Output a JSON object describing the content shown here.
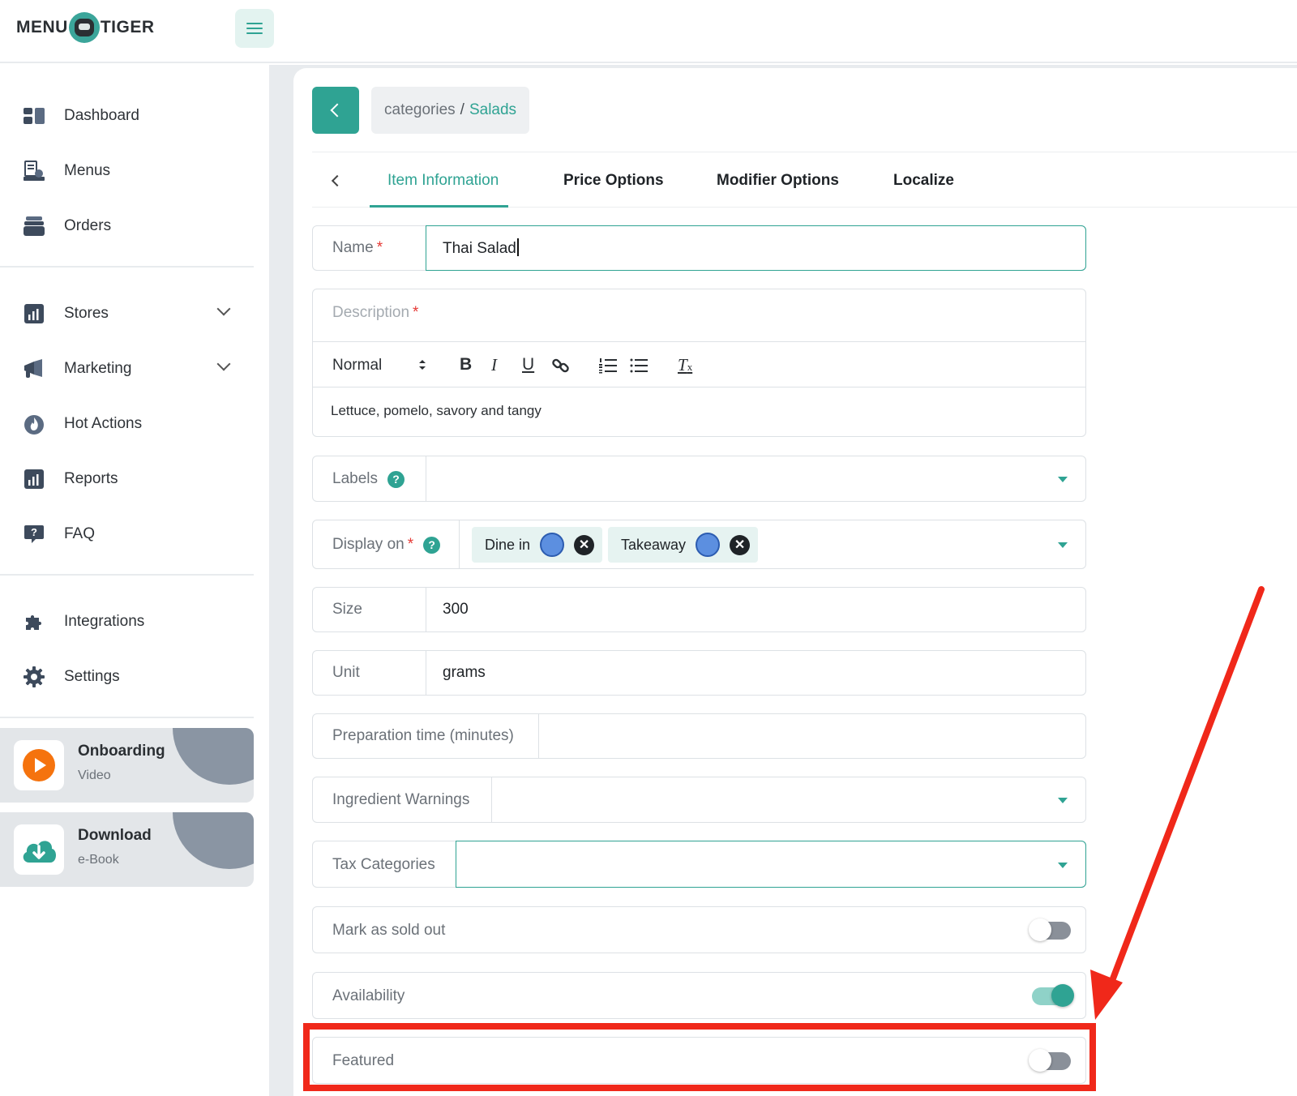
{
  "brand": {
    "logo_left": "MENU",
    "logo_right": "TIGER"
  },
  "sidebar": {
    "items": [
      {
        "label": "Dashboard"
      },
      {
        "label": "Menus"
      },
      {
        "label": "Orders"
      },
      {
        "label": "Stores"
      },
      {
        "label": "Marketing"
      },
      {
        "label": "Hot Actions"
      },
      {
        "label": "Reports"
      },
      {
        "label": "FAQ"
      },
      {
        "label": "Integrations"
      },
      {
        "label": "Settings"
      }
    ],
    "promos": [
      {
        "title": "Onboarding",
        "subtitle": "Video"
      },
      {
        "title": "Download",
        "subtitle": "e-Book"
      }
    ]
  },
  "breadcrumb": {
    "parent": "categories",
    "separator": "/",
    "current": "Salads"
  },
  "tabs": [
    {
      "label": "Item Information",
      "active": true
    },
    {
      "label": "Price Options"
    },
    {
      "label": "Modifier Options"
    },
    {
      "label": "Localize"
    }
  ],
  "form": {
    "name": {
      "label": "Name",
      "required": "*",
      "value": "Thai Salad"
    },
    "description": {
      "label": "Description",
      "required": "*",
      "format": "Normal",
      "toolbar": {
        "bold": "B",
        "italic": "I",
        "underline": "U",
        "clear": "T"
      },
      "value": "Lettuce, pomelo, savory and tangy"
    },
    "labels": {
      "label": "Labels",
      "help": "?"
    },
    "display_on": {
      "label": "Display on",
      "required": "*",
      "help": "?",
      "chips": [
        {
          "label": "Dine in"
        },
        {
          "label": "Takeaway"
        }
      ]
    },
    "size": {
      "label": "Size",
      "value": "300"
    },
    "unit": {
      "label": "Unit",
      "value": "grams"
    },
    "prep_time": {
      "label": "Preparation time (minutes)",
      "value": ""
    },
    "ingredient_warnings": {
      "label": "Ingredient Warnings"
    },
    "tax_categories": {
      "label": "Tax Categories"
    },
    "sold_out": {
      "label": "Mark as sold out",
      "on": false
    },
    "availability": {
      "label": "Availability",
      "on": true
    },
    "featured": {
      "label": "Featured",
      "on": false
    }
  },
  "colors": {
    "accent": "#2fa393",
    "annotation": "#f0281a",
    "required": "#e53935"
  }
}
